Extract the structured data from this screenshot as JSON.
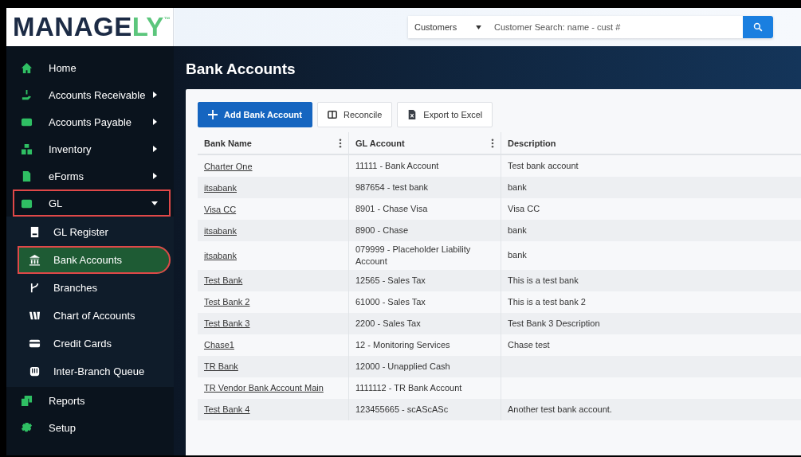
{
  "logo": {
    "text": "MANAGE",
    "accent": "LY",
    "mark": "™"
  },
  "search": {
    "scope": "Customers",
    "placeholder": "Customer Search: name - cust #"
  },
  "sidebar": {
    "items": [
      {
        "label": "Home",
        "kind": "link",
        "selected": false,
        "highlighted": false
      },
      {
        "label": "Accounts Receivable",
        "kind": "menu",
        "expanded": false,
        "selected": false,
        "highlighted": false
      },
      {
        "label": "Accounts Payable",
        "kind": "menu",
        "expanded": false,
        "selected": false,
        "highlighted": false
      },
      {
        "label": "Inventory",
        "kind": "menu",
        "expanded": false,
        "selected": false,
        "highlighted": false
      },
      {
        "label": "eForms",
        "kind": "menu",
        "expanded": false,
        "selected": false,
        "highlighted": false
      },
      {
        "label": "GL",
        "kind": "menu",
        "expanded": true,
        "selected": false,
        "highlighted": true,
        "children": [
          {
            "label": "GL Register",
            "selected": false,
            "highlighted": false
          },
          {
            "label": "Bank Accounts",
            "selected": true,
            "highlighted": true
          },
          {
            "label": "Branches",
            "selected": false,
            "highlighted": false
          },
          {
            "label": "Chart of Accounts",
            "selected": false,
            "highlighted": false
          },
          {
            "label": "Credit Cards",
            "selected": false,
            "highlighted": false
          },
          {
            "label": "Inter-Branch Queue",
            "selected": false,
            "highlighted": false
          }
        ]
      },
      {
        "label": "Reports",
        "kind": "link",
        "selected": false,
        "highlighted": false
      },
      {
        "label": "Setup",
        "kind": "link",
        "selected": false,
        "highlighted": false
      }
    ]
  },
  "page_title": "Bank Accounts",
  "toolbar": [
    {
      "label": "Add Bank Account",
      "kind": "primary"
    },
    {
      "label": "Reconcile",
      "kind": "reconcile"
    },
    {
      "label": "Export to Excel",
      "kind": "excel"
    }
  ],
  "table": {
    "columns": [
      {
        "label": "Bank Name",
        "menu": true
      },
      {
        "label": "GL Account",
        "menu": true
      },
      {
        "label": "Description",
        "menu": false
      }
    ],
    "rows": [
      {
        "bank_name": "Charter One",
        "gl_account": "11111 - Bank Account",
        "description": "Test bank account"
      },
      {
        "bank_name": "itsabank",
        "gl_account": "987654 - test bank",
        "description": "bank"
      },
      {
        "bank_name": "Visa CC",
        "gl_account": "8901 - Chase Visa",
        "description": "Visa CC"
      },
      {
        "bank_name": "itsabank",
        "gl_account": "8900 - Chase",
        "description": "bank"
      },
      {
        "bank_name": "itsabank",
        "gl_account": "079999 - Placeholder Liability Account",
        "description": "bank"
      },
      {
        "bank_name": "Test Bank",
        "gl_account": "12565 - Sales Tax",
        "description": "This is a test bank"
      },
      {
        "bank_name": "Test Bank 2",
        "gl_account": "61000 - Sales Tax",
        "description": "This is a test bank 2"
      },
      {
        "bank_name": "Test Bank 3",
        "gl_account": "2200 - Sales Tax",
        "description": "Test Bank 3 Description"
      },
      {
        "bank_name": "Chase1",
        "gl_account": "12 - Monitoring Services",
        "description": "Chase test"
      },
      {
        "bank_name": "TR Bank",
        "gl_account": "12000 - Unapplied Cash"
      },
      {
        "bank_name": "TR Vendor Bank Account Main",
        "gl_account": "1111112 - TR Bank Account"
      },
      {
        "bank_name": "Test Bank 4",
        "gl_account": "123455665 - scAScASc",
        "description": "Another test bank account."
      }
    ]
  }
}
